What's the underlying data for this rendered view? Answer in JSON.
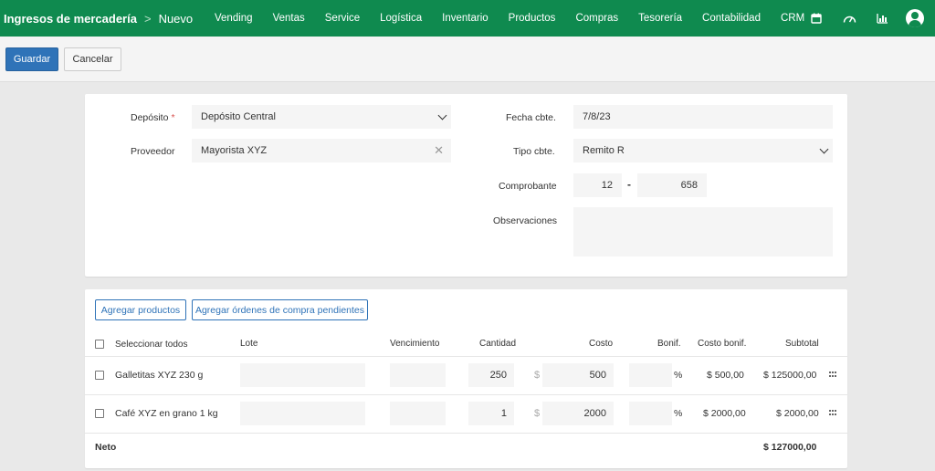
{
  "header": {
    "title": "Ingresos de mercadería",
    "separator": ">",
    "current": "Nuevo",
    "nav": [
      "Vending",
      "Ventas",
      "Service",
      "Logística",
      "Inventario",
      "Productos",
      "Compras",
      "Tesorería",
      "Contabilidad",
      "CRM"
    ],
    "icons": [
      "calendar-icon",
      "dashboard-icon",
      "chart-icon",
      "user-icon"
    ]
  },
  "toolbar": {
    "save_label": "Guardar",
    "cancel_label": "Cancelar"
  },
  "form": {
    "deposito_label": "Depósito",
    "deposito_required": "*",
    "deposito_value": "Depósito Central",
    "proveedor_label": "Proveedor",
    "proveedor_value": "Mayorista XYZ",
    "proveedor_clear": "✕",
    "fecha_label": "Fecha cbte.",
    "fecha_value": "7/8/23",
    "tipo_label": "Tipo cbte.",
    "tipo_value": "Remito R",
    "comprobante_label": "Comprobante",
    "comprobante_punto": "12",
    "comprobante_dash": "-",
    "comprobante_numero": "658",
    "observaciones_label": "Observaciones",
    "observaciones_value": ""
  },
  "items": {
    "add_products_label": "Agregar productos",
    "add_orders_label": "Agregar órdenes de compra pendientes",
    "columns": {
      "select_all": "Seleccionar todos",
      "lote": "Lote",
      "vencimiento": "Vencimiento",
      "cantidad": "Cantidad",
      "costo": "Costo",
      "bonif": "Bonif.",
      "costo_bonif": "Costo bonif.",
      "subtotal": "Subtotal"
    },
    "rows": [
      {
        "product": "Galletitas XYZ 230 g",
        "lote": "",
        "vencimiento": "",
        "cantidad": "250",
        "currency": "$",
        "costo": "500",
        "bonif": "",
        "percent": "%",
        "costo_bonif": "$ 500,00",
        "subtotal": "$ 125000,00"
      },
      {
        "product": "Café XYZ en grano 1 kg",
        "lote": "",
        "vencimiento": "",
        "cantidad": "1",
        "currency": "$",
        "costo": "2000",
        "bonif": "",
        "percent": "%",
        "costo_bonif": "$ 2000,00",
        "subtotal": "$ 2000,00"
      }
    ],
    "neto_label": "Neto",
    "neto_value": "$ 127000,00"
  },
  "colors": {
    "header_bg": "#0f8a4f",
    "primary": "#2f73b8",
    "page_bg": "#e9e9e9"
  }
}
